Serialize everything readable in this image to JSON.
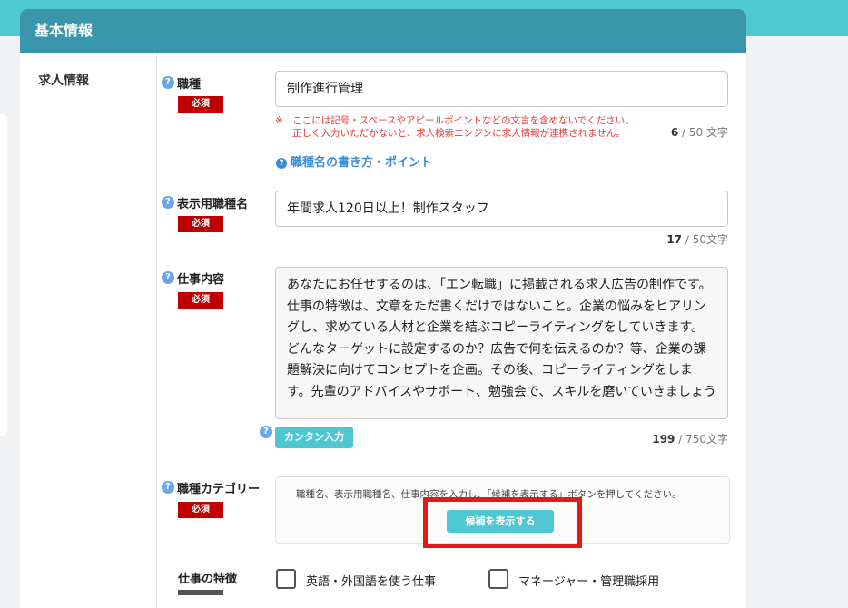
{
  "panel": {
    "title": "基本情報"
  },
  "section": {
    "label": "求人情報"
  },
  "job_type": {
    "label": "職種",
    "required": "必須",
    "value": "制作進行管理",
    "warning_line1": "※　ここには記号・スペースやアピールポイントなどの文言を含めないでください。",
    "warning_line2": "正しく入力いただかないと、求人検索エンジンに求人情報が連携されません。",
    "count": "6",
    "max": "/ 50 文字",
    "help_link": "職種名の書き方・ポイント"
  },
  "display_job_type": {
    "label": "表示用職種名",
    "required": "必須",
    "value": "年間求人120日以上！制作スタッフ",
    "count": "17",
    "max": "/ 50文字"
  },
  "job_content": {
    "label": "仕事内容",
    "required": "必須",
    "value": "あなたにお任せするのは、「エン転職」に掲載される求人広告の制作です。仕事の特徴は、文章をただ書くだけではないこと。企業の悩みをヒアリングし、求めている人材と企業を結ぶコピーライティングをしていきます。どんなターゲットに設定するのか？広告で何を伝えるのか？等、企業の課題解決に向けてコンセプトを企画。その後、コピーライティングをします。先輩のアドバイスやサポート、勉強会で、スキルを磨いていきましょう",
    "easy_input": "カンタン入力",
    "count": "199",
    "max": "/ 750文字"
  },
  "job_category": {
    "label": "職種カテゴリー",
    "required": "必須",
    "hint": "職種名、表示用職種名、仕事内容を入力し、「候補を表示する」ボタンを押してください。",
    "show_candidates": "候補を表示する"
  },
  "features": {
    "label": "仕事の特徴",
    "options": [
      "英語・外国語を使う仕事",
      "マネージャー・管理職採用"
    ]
  },
  "help_icon": "question-icon"
}
